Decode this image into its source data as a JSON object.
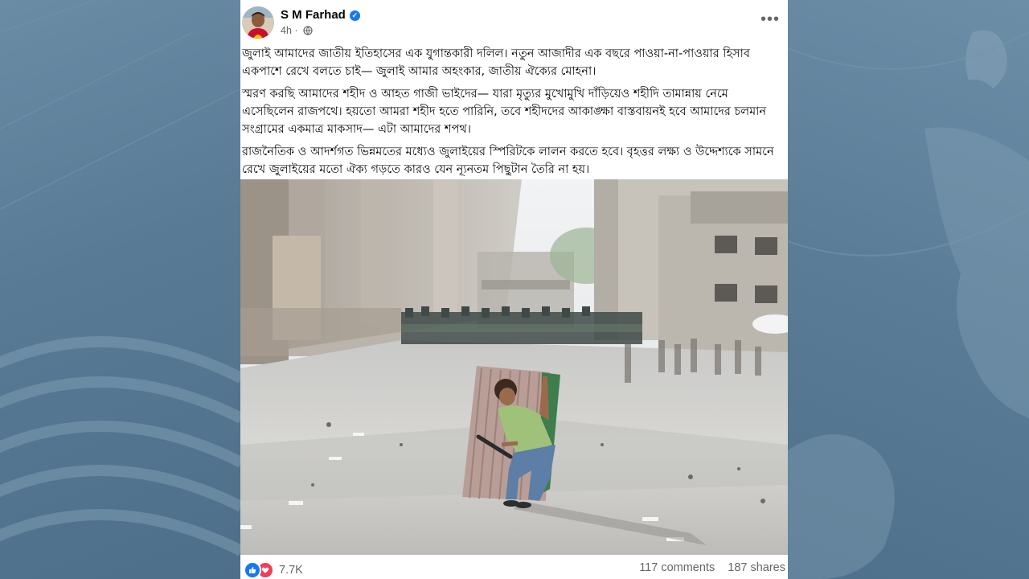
{
  "post": {
    "author": "S M Farhad",
    "time": "4h",
    "separator": "·",
    "paragraphs": [
      "জুলাই আমাদের জাতীয় ইতিহাসের এক যুগান্তকারী দলিল। নতুন আজাদীর এক বছরে পাওয়া-না-পাওয়ার হিসাব একপাশে রেখে বলতে চাই— জুলাই আমার অহংকার, জাতীয় ঐক্যের মোহনা।",
      "স্মরণ করছি আমাদের শহীদ ও আহত গাজী ভাইদের— যারা মৃত্যুর মুখোমুখি দাঁড়িয়েও শহীদি তামান্নায় নেমে এসেছিলেন রাজপথে। হয়তো আমরা শহীদ হতে পারিনি, তবে শহীদদের আকাঙ্ক্ষা বাস্তবায়নই হবে আমাদের চলমান সংগ্রামের একমাত্র মাকসাদ— এটা আমাদের শপথ।",
      "রাজনৈতিক ও আদর্শগত ভিন্নমতের মধ্যেও জুলাইয়ের স্পিরিটকে লালন করতে হবে। বৃহত্তর লক্ষ্য ও উদ্দেশ্যকে সামনে রেখে জুলাইয়ের মতো ঐক্য গড়তে কারও যেন ন্যূনতম পিছুটান তৈরি না হয়।"
    ],
    "reactions_count": "7.7K",
    "comments": "117 comments",
    "shares": "187 shares"
  },
  "icons": {
    "verified": "verified-badge-icon",
    "privacy": "globe-icon",
    "more": "more-options-icon",
    "like": "like-reaction-icon",
    "love": "love-reaction-icon"
  },
  "colors": {
    "verified_blue": "#1877f2",
    "love_red": "#f33e58",
    "meta_gray": "#65676b",
    "background": "#5d7f98"
  }
}
